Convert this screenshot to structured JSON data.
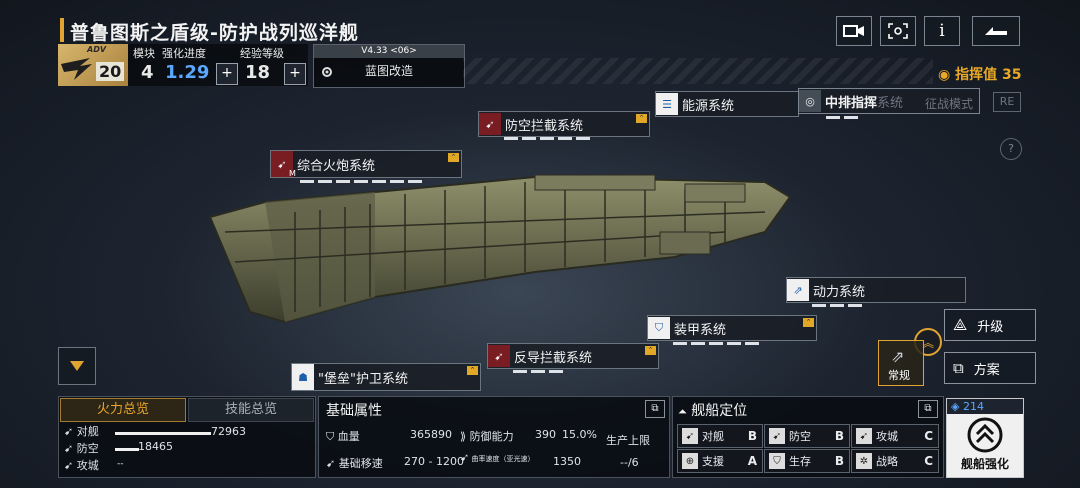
{
  "header": {
    "title": "普鲁图斯之盾级-防护战列巡洋舰",
    "buttons": [
      "video-icon",
      "scan-icon",
      "info-icon",
      "back-icon"
    ],
    "info_label": "i"
  },
  "stats": {
    "adv_tag": "ADV",
    "level": "20",
    "module_label": "模块",
    "module_value": "4",
    "enhance_label": "强化进度",
    "enhance_value": "1.29",
    "exp_label": "经验等级",
    "exp_value": "18",
    "plus": "+"
  },
  "version": {
    "version": "V4.33 <06>",
    "remodel_label": "蓝图改造"
  },
  "command": {
    "label": "指挥值",
    "value": "35"
  },
  "systems": {
    "energy": "能源系统",
    "antiair": "防空拦截系统",
    "central": "中排指挥",
    "central_faded": "系统",
    "campaign": "征战模式",
    "re": "RE",
    "artillery": "综合火炮系统",
    "artillery_tag": "M",
    "power": "动力系统",
    "armor": "装甲系统",
    "antiguide": "反导拦截系统",
    "fortress": "\"堡垒\"护卫系统",
    "help": "?"
  },
  "right_buttons": {
    "upgrade": "升级",
    "plan": "方案",
    "normal": "常规"
  },
  "firepower": {
    "tab_active": "火力总览",
    "tab_inactive": "技能总览",
    "rows": [
      {
        "label": "对舰",
        "value": "72963",
        "fraction": 0.8
      },
      {
        "label": "防空",
        "value": "18465",
        "fraction": 0.2
      },
      {
        "label": "攻城",
        "value": "--",
        "fraction": 0.0
      }
    ]
  },
  "base_attr": {
    "title": "基础属性",
    "hp_label": "血量",
    "hp_value": "365890",
    "def_label": "防御能力",
    "def_value": "390",
    "def_pct": "15.0%",
    "prod_label": "生产上限",
    "prod_value": "--/6",
    "speed_label": "基础移速",
    "speed_value": "270 - 1200",
    "warp_label": "曲率速度（亚光速）",
    "warp_value": "1350"
  },
  "positioning": {
    "title": "舰船定位",
    "roles": [
      {
        "label": "对舰",
        "grade": "B"
      },
      {
        "label": "防空",
        "grade": "B"
      },
      {
        "label": "攻城",
        "grade": "C"
      },
      {
        "label": "支援",
        "grade": "A"
      },
      {
        "label": "生存",
        "grade": "B"
      },
      {
        "label": "战略",
        "grade": "C"
      }
    ]
  },
  "enhance": {
    "count": "214",
    "label": "舰船强化"
  },
  "colors": {
    "accent": "#e2a431",
    "blue_value": "#5aa8ff",
    "red_icon": "#7a1d22",
    "blue_icon": "#1f5fa8"
  }
}
